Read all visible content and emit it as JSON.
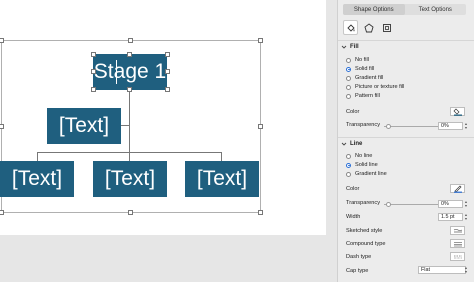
{
  "tabs": [
    {
      "label": "Shape Options",
      "active": true
    },
    {
      "label": "Text Options",
      "active": false
    }
  ],
  "icons": [
    "paint-bucket-icon",
    "pentagon-icon",
    "size-layout-icon"
  ],
  "diagram": {
    "top_box": "Stage 1",
    "assistant_box": "[Text]",
    "child_boxes": [
      "[Text]",
      "[Text]",
      "[Text]"
    ],
    "box_color": "#1f5f7f"
  },
  "fill": {
    "header": "Fill",
    "options": [
      "No fill",
      "Solid fill",
      "Gradient fill",
      "Picture or texture fill",
      "Pattern fill"
    ],
    "selected": "Solid fill",
    "color_label": "Color",
    "transparency_label": "Transparency",
    "transparency_value": "0%"
  },
  "line": {
    "header": "Line",
    "options": [
      "No line",
      "Solid line",
      "Gradient line"
    ],
    "selected": "Solid line",
    "color_label": "Color",
    "transparency_label": "Transparency",
    "transparency_value": "0%",
    "width_label": "Width",
    "width_value": "1.5 pt",
    "sketched_label": "Sketched style",
    "compound_label": "Compound type",
    "dash_label": "Dash type",
    "cap_label": "Cap type",
    "cap_value": "Flat"
  }
}
